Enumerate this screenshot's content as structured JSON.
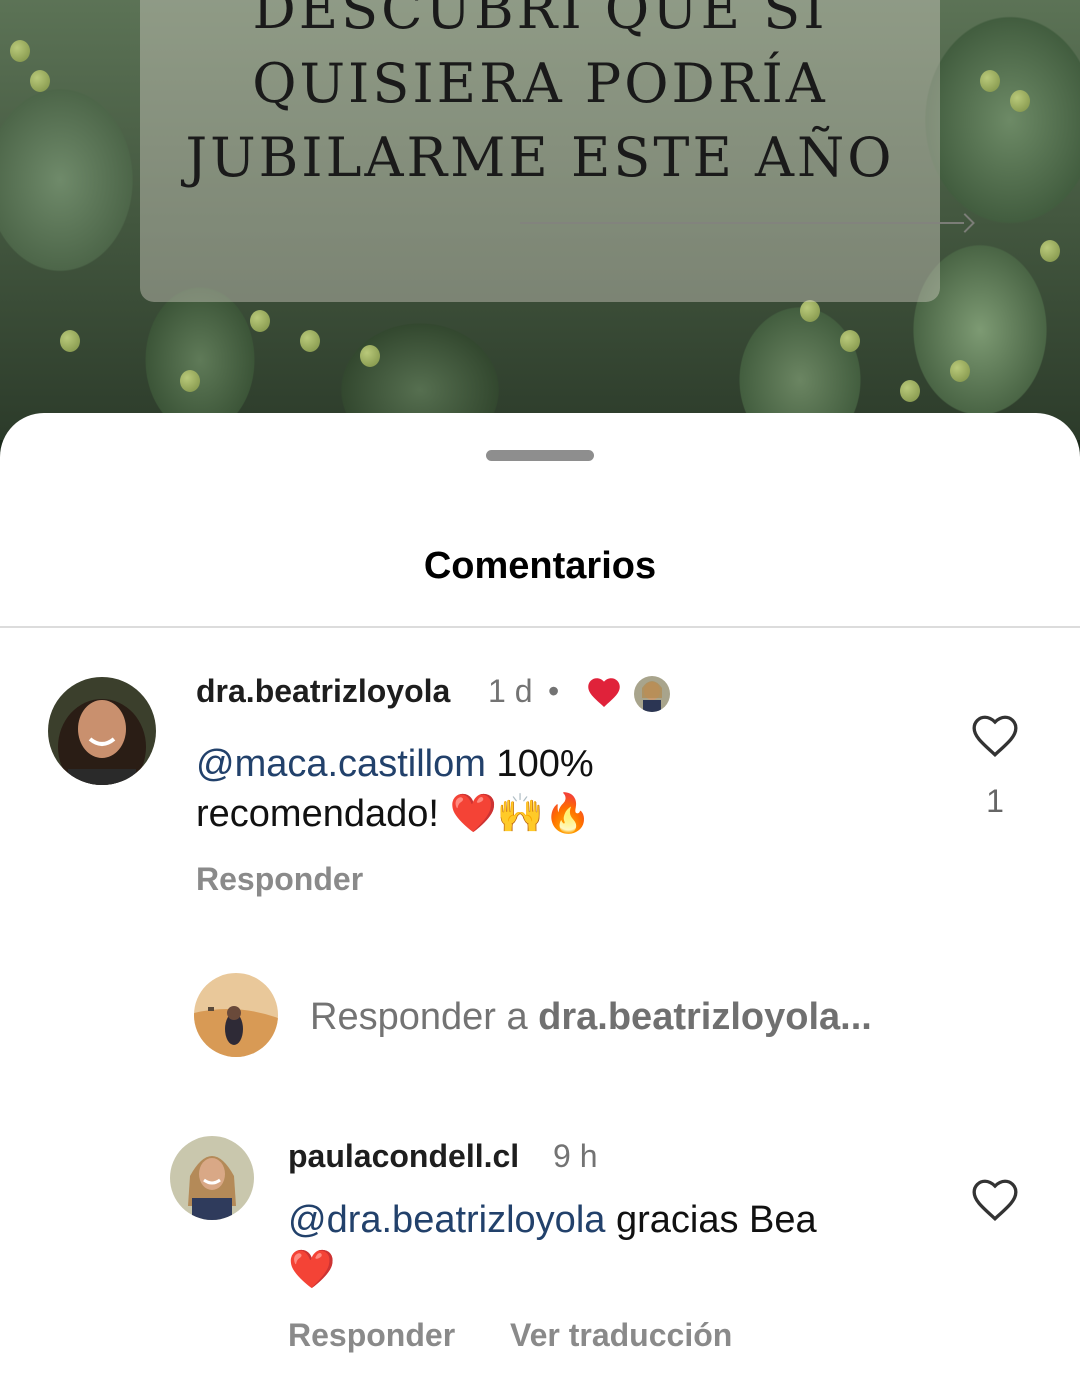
{
  "post": {
    "title_lines": [
      "DESCUBRÍ QUE SI",
      "QUISIERA PODRÍA",
      "JUBILARME ESTE AÑO"
    ]
  },
  "sheet": {
    "title": "Comentarios"
  },
  "comment1": {
    "username": "dra.beatrizloyola",
    "time": "1 d",
    "separator": "•",
    "mention": "@maca.castillom",
    "text_line1": " 100%",
    "text_line2": "recomendado! ",
    "emojis": [
      "❤️",
      "🙌",
      "🔥"
    ],
    "like_count": "1",
    "reply_label": "Responder"
  },
  "reply_input": {
    "prefix": "Responder a ",
    "target": "dra.beatrizloyola..."
  },
  "comment2": {
    "username": "paulacondell.cl",
    "time": "9 h",
    "mention": "@dra.beatrizloyola",
    "text": " gracias Bea",
    "emoji": "❤️",
    "reply_label": "Responder",
    "translate_label": "Ver traducción"
  },
  "colors": {
    "mention": "#22416b",
    "heart_red": "#e0223a",
    "secondary_text": "#737373"
  },
  "icons": [
    "heart-outline-icon",
    "red-heart-icon"
  ]
}
